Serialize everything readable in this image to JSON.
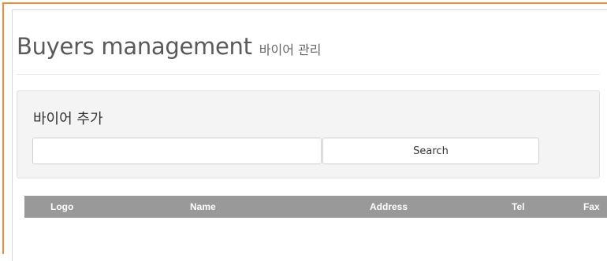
{
  "page": {
    "title": "Buyers management",
    "subtitle": "바이어 관리"
  },
  "search": {
    "heading": "바이어 추가",
    "input_value": "",
    "input_placeholder": "",
    "button_label": "Search"
  },
  "table": {
    "columns": [
      "Logo",
      "Name",
      "Address",
      "Tel",
      "Fax"
    ]
  },
  "colors": {
    "frame_accent": "#f08a2e",
    "table_header_bg": "#999999"
  }
}
